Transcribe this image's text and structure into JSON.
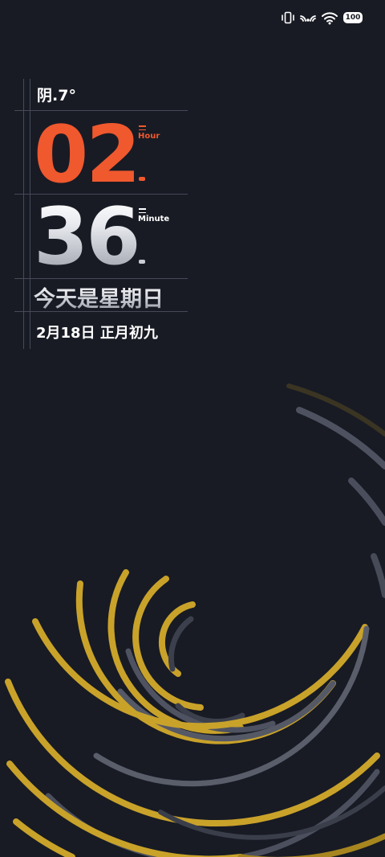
{
  "status_bar": {
    "icons": [
      "vibrate-icon",
      "hotspot-icon",
      "wifi-icon",
      "battery-icon"
    ],
    "battery_level": "100"
  },
  "widget": {
    "weather": "阴.7°",
    "hour": "02",
    "hour_label": "Hour",
    "minute": "36",
    "minute_label": "Minute",
    "weekday": "今天是星期日",
    "date": "2月18日 正月初九"
  },
  "colors": {
    "background": "#181b24",
    "accent_orange": "#f0582e",
    "arc_gold": "#c9a22a",
    "arc_gray": "#575b68"
  }
}
